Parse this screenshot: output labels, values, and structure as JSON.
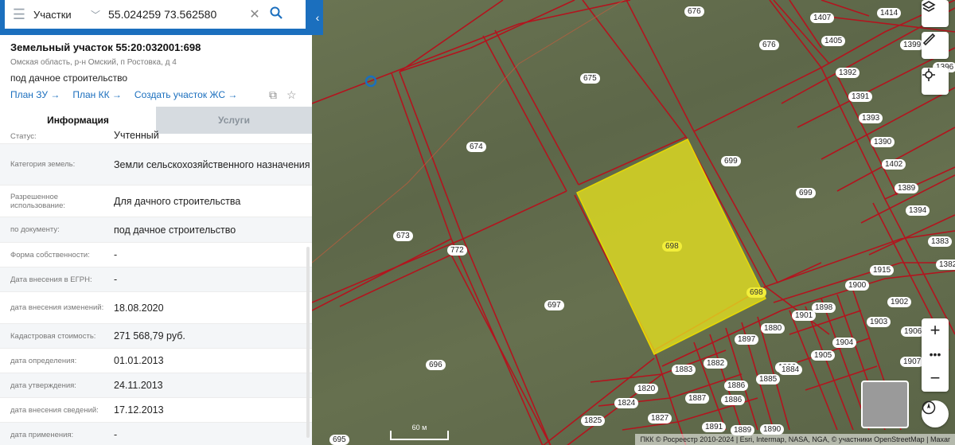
{
  "search": {
    "type": "Участки",
    "value": "55.024259 73.562580"
  },
  "parcel": {
    "title": "Земельный участок 55:20:032001:698",
    "address": "Омская область, р-н Омский, п Ростовка, д 4",
    "usage": "под дачное строительство",
    "links": [
      "План ЗУ →",
      "План КК →",
      "Создать участок ЖС →"
    ]
  },
  "tabs": {
    "info": "Информация",
    "services": "Услуги"
  },
  "rows": [
    {
      "label": "Статус:",
      "value": "Учтенный"
    },
    {
      "label": "Категория земель:",
      "value": "Земли сельскохозяйственного назначения"
    },
    {
      "label": "Разрешенное использование:",
      "value": "Для дачного строительства"
    },
    {
      "label": "по документу:",
      "value": "под дачное строительство"
    },
    {
      "label": "Форма собственности:",
      "value": "-"
    },
    {
      "label": "Дата внесения в ЕГРН:",
      "value": "-"
    },
    {
      "label": "дата внесения изменений:",
      "value": "18.08.2020"
    },
    {
      "label": "Кадастровая стоимость:",
      "value": "271 568,79 руб."
    },
    {
      "label": "дата определения:",
      "value": "01.01.2013"
    },
    {
      "label": "дата утверждения:",
      "value": "24.11.2013"
    },
    {
      "label": "дата внесения сведений:",
      "value": "17.12.2013"
    },
    {
      "label": "дата применения:",
      "value": "-"
    }
  ],
  "map": {
    "labels": [
      "676",
      "1407",
      "1414",
      "1405",
      "1399",
      "1396",
      "675",
      "676",
      "1392",
      "1391",
      "1393",
      "1390",
      "674",
      "699",
      "1402",
      "1389",
      "699",
      "1394",
      "673",
      "772",
      "698",
      "698",
      "1383",
      "1382",
      "1915",
      "1900",
      "1902",
      "697",
      "1901",
      "1898",
      "1903",
      "1880",
      "1897",
      "1904",
      "1906",
      "1905",
      "1907",
      "1896",
      "696",
      "1883",
      "1882",
      "1886",
      "1885",
      "1884",
      "1887",
      "1820",
      "1886",
      "1824",
      "1825",
      "1827",
      "1891",
      "1889",
      "695",
      "1890"
    ],
    "scale": "60 м",
    "attribution": "ПКК © Росреестр 2010-2024 | Esri, Intermap, NASA, NGA, © участники OpenStreetMap | Maxar"
  },
  "colors": {
    "brand": "#1b6fbe",
    "highlight": "#e6e21f",
    "boundary": "#b3141e"
  }
}
